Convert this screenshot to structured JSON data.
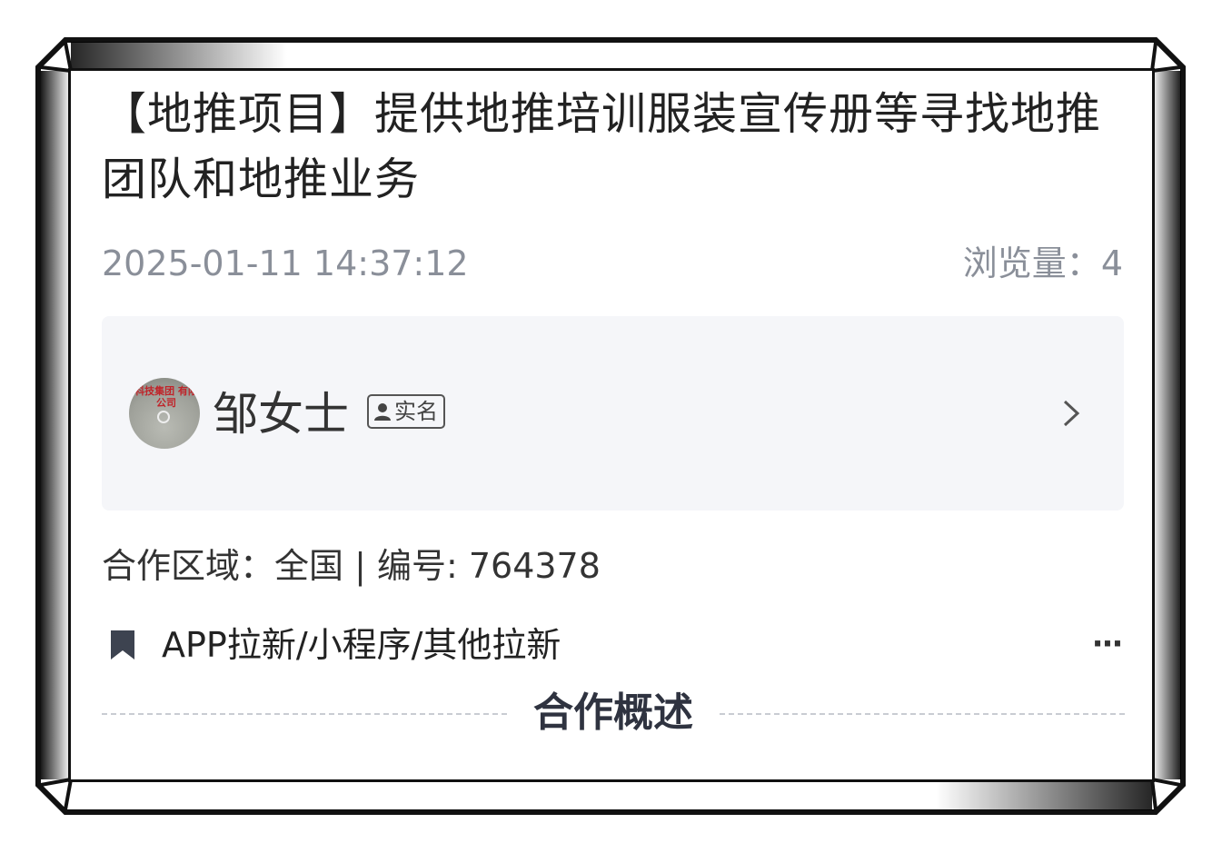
{
  "post": {
    "title": "【地推项目】提供地推培训服装宣传册等寻找地推团队和地推业务",
    "timestamp": "2025-01-11 14:37:12",
    "views_label": "浏览量：",
    "views_count": "4"
  },
  "user": {
    "name": "邹女士",
    "verified_label": "实名",
    "avatar_text": "科技集团 有限公司"
  },
  "info": {
    "line": "合作区域：全国 | 编号: 764378"
  },
  "tag": {
    "icon": "bookmark-icon",
    "text": "APP拉新/小程序/其他拉新",
    "more_icon": "more-horizontal-icon"
  },
  "section": {
    "title": "合作概述"
  },
  "colors": {
    "text_primary": "#222222",
    "text_meta": "#8a8f99",
    "card_bg": "#f5f6f9",
    "frame": "#111111"
  }
}
